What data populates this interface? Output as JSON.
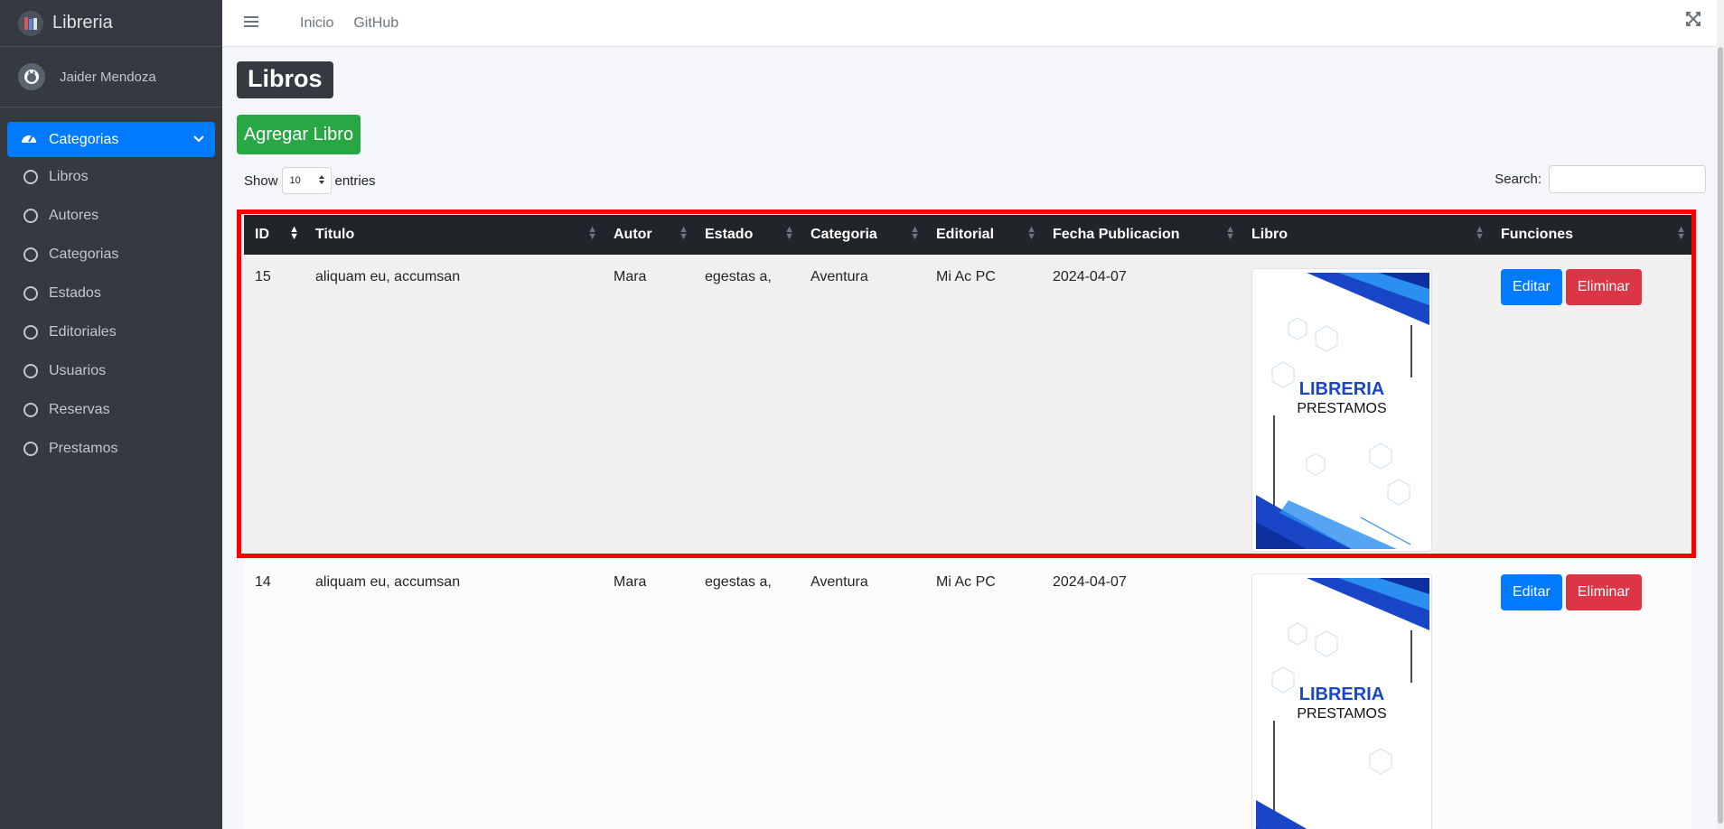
{
  "brand": {
    "name": "Libreria",
    "logo_icon": "book-stack-icon"
  },
  "user": {
    "name": "Jaider Mendoza",
    "avatar_icon": "github-cat-icon"
  },
  "sidebar": {
    "active": {
      "label": "Categorias",
      "icon": "dashboard-gauge-icon"
    },
    "items": [
      {
        "label": "Libros"
      },
      {
        "label": "Autores"
      },
      {
        "label": "Categorias"
      },
      {
        "label": "Estados"
      },
      {
        "label": "Editoriales"
      },
      {
        "label": "Usuarios"
      },
      {
        "label": "Reservas"
      },
      {
        "label": "Prestamos"
      }
    ]
  },
  "topbar": {
    "links": [
      "Inicio",
      "GitHub"
    ],
    "menu_icon": "hamburger-icon",
    "fullscreen_icon": "expand-icon"
  },
  "page": {
    "title": "Libros",
    "add_button": "Agregar Libro"
  },
  "datatable": {
    "show_label": "Show",
    "entries_value": "10",
    "entries_label": "entries",
    "search_label": "Search:",
    "search_value": ""
  },
  "table": {
    "headers": [
      "ID",
      "Titulo",
      "Autor",
      "Estado",
      "Categoria",
      "Editorial",
      "Fecha Publicacion",
      "Libro",
      "Funciones"
    ],
    "rows": [
      {
        "id": "15",
        "titulo": "aliquam eu, accumsan",
        "autor": "Mara",
        "estado": "egestas a,",
        "categoria": "Aventura",
        "editorial": "Mi Ac PC",
        "fecha": "2024-04-07",
        "cover_title": "LIBRERIA",
        "cover_sub": "PRESTAMOS"
      },
      {
        "id": "14",
        "titulo": "aliquam eu, accumsan",
        "autor": "Mara",
        "estado": "egestas a,",
        "categoria": "Aventura",
        "editorial": "Mi Ac PC",
        "fecha": "2024-04-07",
        "cover_title": "LIBRERIA",
        "cover_sub": "PRESTAMOS"
      }
    ],
    "edit_label": "Editar",
    "delete_label": "Eliminar"
  },
  "colors": {
    "primary": "#007bff",
    "success": "#28a745",
    "danger": "#dc3545",
    "sidebar": "#343a40",
    "highlight": "#ff0000",
    "cover_blue": "#1846c7"
  }
}
